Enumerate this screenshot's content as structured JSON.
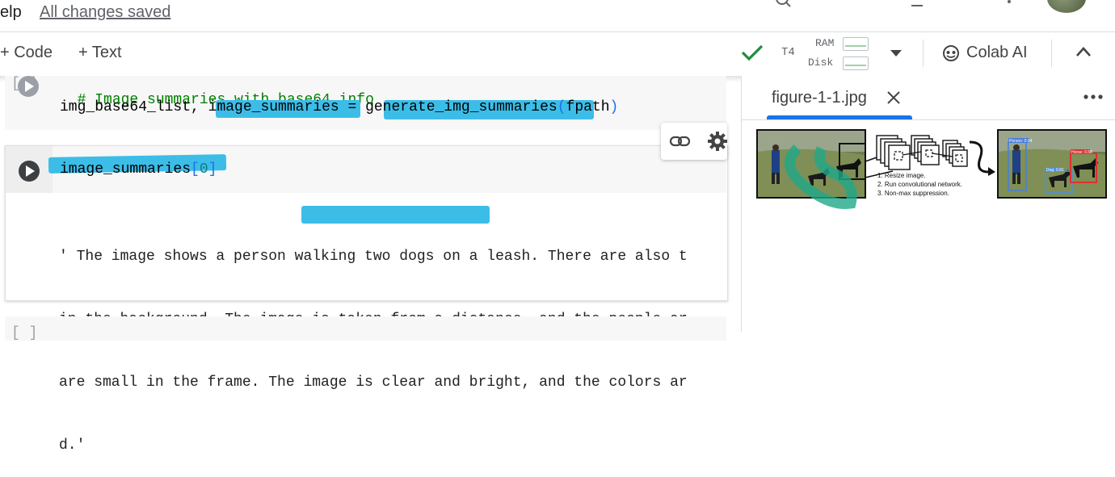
{
  "menu": {
    "help_partial": "elp",
    "save_status": "All changes saved"
  },
  "toolbar": {
    "add_code": "+ Code",
    "add_text": "+ Text",
    "runtime": "T4",
    "ram_label": "RAM",
    "disk_label": "Disk",
    "colab_ai": "Colab AI",
    "accent_color": "#1e8e3e"
  },
  "cells": [
    {
      "exec_count": "[ ]",
      "comment": "# Image summaries with base64 info",
      "code_parts": [
        "img_base64_list, ",
        "image_summaries",
        " = ",
        "generate_img_summaries",
        "(",
        "fpath",
        ")"
      ]
    },
    {
      "code_parts": [
        "image_summaries",
        "[",
        "0",
        "]"
      ],
      "output_lines": [
        "' The image shows a person walking two dogs on a leash. There are also t",
        "in the background. The image is taken from a distance, and the people ar",
        "are small in the frame. The image is clear and bright, and the colors ar",
        "d.'"
      ]
    },
    {
      "exec_count": "[ ]"
    }
  ],
  "highlight_color": "#3cbde8",
  "panel": {
    "tab_title": "figure-1-1.jpg",
    "figure_steps": [
      "1. Resize image.",
      "2. Run convolutional network.",
      "3. Non-max suppression."
    ],
    "figure_labels": {
      "person": "Person: 0.94",
      "dog_small": "Dog: 0.81",
      "dog_large": "Horse: 0.58"
    }
  }
}
